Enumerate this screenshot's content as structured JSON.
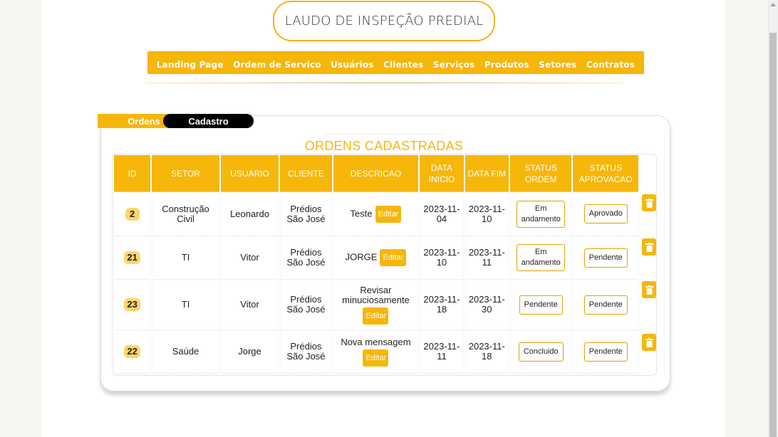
{
  "header": {
    "title": "LAUDO DE INSPEÇÃO PREDIAL"
  },
  "nav": [
    "Landing Page",
    "Ordem de Servico",
    "Usuários",
    "Clientes",
    "Serviços",
    "Produtos",
    "Setores",
    "Contratos"
  ],
  "tabs": {
    "ordens": "Ordens",
    "cadastro": "Cadastro"
  },
  "table": {
    "title": "ORDENS CADASTRADAS",
    "headers": [
      "ID",
      "SETOR",
      "USUARIO",
      "CLIENTE",
      "DESCRICAO",
      "DATA INICIO",
      "DATA FIM",
      "STATUS ORDEM",
      "STATUS APROVACAO"
    ],
    "edit_label": "Editar",
    "rows": [
      {
        "id": "2",
        "setor": "Construção Civil",
        "usuario": "Leonardo",
        "cliente": "Prédios São José",
        "descricao": "Teste",
        "inicio": "2023-11-04",
        "fim": "2023-11-10",
        "status_ordem": "Em andamento",
        "status_aprovacao": "Aprovado"
      },
      {
        "id": "21",
        "setor": "TI",
        "usuario": "Vitor",
        "cliente": "Prédios São José",
        "descricao": "JORGE",
        "inicio": "2023-11-10",
        "fim": "2023-11-11",
        "status_ordem": "Em andamento",
        "status_aprovacao": "Pendente"
      },
      {
        "id": "23",
        "setor": "TI",
        "usuario": "Vitor",
        "cliente": "Prédios São José",
        "descricao": "Revisar minuciosamente",
        "inicio": "2023-11-18",
        "fim": "2023-11-30",
        "status_ordem": "Pendente",
        "status_aprovacao": "Pendente"
      },
      {
        "id": "22",
        "setor": "Saúde",
        "usuario": "Jorge",
        "cliente": "Prédios São José",
        "descricao": "Nova mensagem",
        "inicio": "2023-11-11",
        "fim": "2023-11-18",
        "status_ordem": "Concluido",
        "status_aprovacao": "Pendente"
      }
    ]
  },
  "colors": {
    "accent": "#f6b60a",
    "badge": "#fbd66a"
  },
  "icons": {
    "delete": "trash-icon"
  }
}
